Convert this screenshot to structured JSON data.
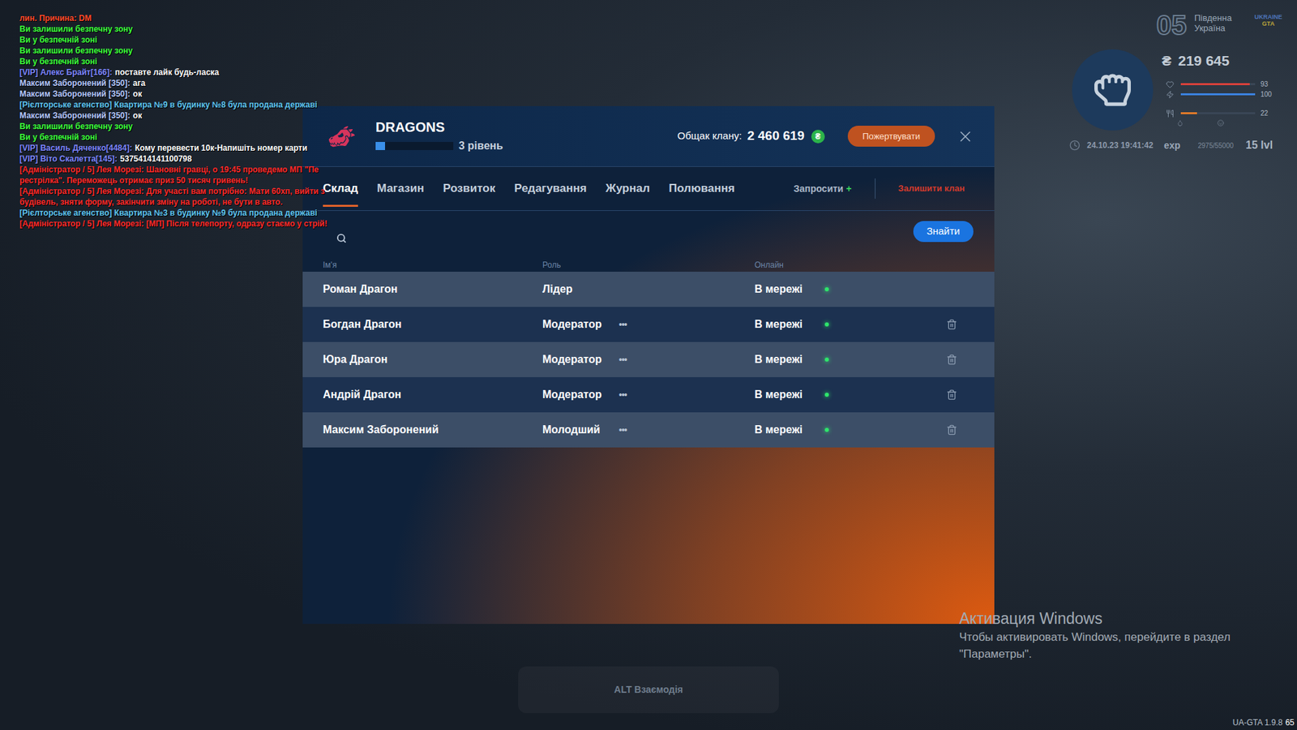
{
  "chat": [
    {
      "segments": [
        {
          "text": "лин. Причина: DM",
          "color": "#ff4a2a"
        }
      ]
    },
    {
      "segments": [
        {
          "text": "Ви залишили безпечну зону",
          "color": "#3cff3c"
        }
      ]
    },
    {
      "segments": [
        {
          "text": "Ви у безпечній зоні",
          "color": "#3cff3c"
        }
      ]
    },
    {
      "segments": [
        {
          "text": "Ви залишили безпечну зону",
          "color": "#3cff3c"
        }
      ]
    },
    {
      "segments": [
        {
          "text": "Ви у безпечній зоні",
          "color": "#3cff3c"
        }
      ]
    },
    {
      "segments": [
        {
          "text": "[VIP] Алекс Брайт[166]:",
          "color": "#7d86ff"
        },
        {
          "text": "поставте лайк будь-ласка",
          "color": "#ffffff"
        }
      ]
    },
    {
      "segments": [
        {
          "text": "Максим Заборонений [350]:",
          "color": "#b6c9ff"
        },
        {
          "text": "ага",
          "color": "#ffffff"
        }
      ]
    },
    {
      "segments": [
        {
          "text": "Максим Заборонений [350]:",
          "color": "#b6c9ff"
        },
        {
          "text": "ок",
          "color": "#ffffff"
        }
      ]
    },
    {
      "segments": [
        {
          "text": "[Рієлторське агенство] Квартира №9 в будинку №8 була продана державі",
          "color": "#5ec6f2"
        }
      ]
    },
    {
      "segments": [
        {
          "text": "Максим Заборонений [350]:",
          "color": "#b6c9ff"
        },
        {
          "text": "ок",
          "color": "#ffffff"
        }
      ]
    },
    {
      "segments": [
        {
          "text": "Ви залишили безпечну зону",
          "color": "#3cff3c"
        }
      ]
    },
    {
      "segments": [
        {
          "text": "Ви у безпечній зоні",
          "color": "#3cff3c"
        }
      ]
    },
    {
      "segments": [
        {
          "text": "[VIP] Василь Дяченко[4484]:",
          "color": "#7d86ff"
        },
        {
          "text": "Кому перевести 10к-Напишіть номер карти",
          "color": "#ffffff"
        }
      ]
    },
    {
      "segments": [
        {
          "text": "[VIP] Віто Скалетта[145]:",
          "color": "#7d86ff"
        },
        {
          "text": "5375414141100798",
          "color": "#ffffff"
        }
      ]
    },
    {
      "segments": [
        {
          "text": "[Адміністратор / 5] Лея Морезі: Шановні гравці, о 19:45 проведемо МП \"Пе",
          "color": "#ff2b2b"
        }
      ]
    },
    {
      "segments": [
        {
          "text": "рестрілка\". Переможець отримає приз 50 тисяч гривень!",
          "color": "#ff2b2b"
        }
      ]
    },
    {
      "segments": [
        {
          "text": "[Адміністратор / 5] Лея Морезі: Для участі вам потрібно: Мати 60хп, вийти з",
          "color": "#ff2b2b"
        }
      ]
    },
    {
      "segments": [
        {
          "text": "будівель, зняти форму, закінчити зміну на роботі, не бути в авто.",
          "color": "#ff2b2b"
        }
      ]
    },
    {
      "segments": [
        {
          "text": "[Рієлторське агенство] Квартира №3 в будинку №9 була продана державі",
          "color": "#5ec6f2"
        }
      ]
    },
    {
      "segments": [
        {
          "text": "[Адміністратор / 5] Лея Морезі: [МП] Після телепорту, одразу стаємо у стрій!",
          "color": "#ff2b2b"
        }
      ]
    }
  ],
  "hud": {
    "server_number": "05",
    "server_name": [
      "Південна",
      "Україна"
    ],
    "logo": [
      "UKRAINE",
      "GTA"
    ],
    "currency": "₴",
    "money": "219 645",
    "stats": [
      {
        "value": "93",
        "level": 0.93,
        "color": "#d9413b"
      },
      {
        "value": "100",
        "level": 1,
        "color": "#3b82e0"
      },
      {
        "value": "22",
        "level": 0.22,
        "color": "#e07a2a"
      }
    ],
    "datetime": "24.10.23 19:41:42",
    "exp_label": "exp",
    "exp": "2975/55000",
    "level_label": "15 lvl"
  },
  "clan": {
    "name": "DRAGONS",
    "level_label": "3 рівень",
    "level_progress": 0.12,
    "treasury_label": "Общак клану:",
    "treasury": "2 460 619",
    "currency": "₴",
    "donate_button": "Пожертвувати",
    "tabs": [
      {
        "label": "Склад",
        "selected": true
      },
      {
        "label": "Магазин",
        "selected": false
      },
      {
        "label": "Розвиток",
        "selected": false
      },
      {
        "label": "Редагування",
        "selected": false
      },
      {
        "label": "Журнал",
        "selected": false
      },
      {
        "label": "Полювання",
        "selected": false
      }
    ],
    "invite_label": "Запросити",
    "invite_plus": "+",
    "leave_label": "Залишити клан",
    "search_button": "Знайти",
    "columns": [
      "Ім'я",
      "Роль",
      "Онлайн"
    ],
    "members": [
      {
        "name": "Роман Драгон",
        "role": "Лідер",
        "menu": "",
        "status": "В мережі",
        "online": true,
        "removable": false
      },
      {
        "name": "Богдан Драгон",
        "role": "Модератор",
        "menu": "•••",
        "status": "В мережі",
        "online": true,
        "removable": true
      },
      {
        "name": "Юра Драгон",
        "role": "Модератор",
        "menu": "•••",
        "status": "В мережі",
        "online": true,
        "removable": true
      },
      {
        "name": "Андрій Драгон",
        "role": "Модератор",
        "menu": "•••",
        "status": "В мережі",
        "online": true,
        "removable": true
      },
      {
        "name": "Максим Заборонений",
        "role": "Молодший",
        "menu": "•••",
        "status": "В мережі",
        "online": true,
        "removable": true
      }
    ]
  },
  "interaction_hint": "ALT Взаємодія",
  "windows_activation": {
    "title": "Активация Windows",
    "lines": [
      "Чтобы активировать Windows, перейдите в раздел",
      "\"Параметры\"."
    ]
  },
  "version": "UA-GTA 1.9.8",
  "fps": "65"
}
